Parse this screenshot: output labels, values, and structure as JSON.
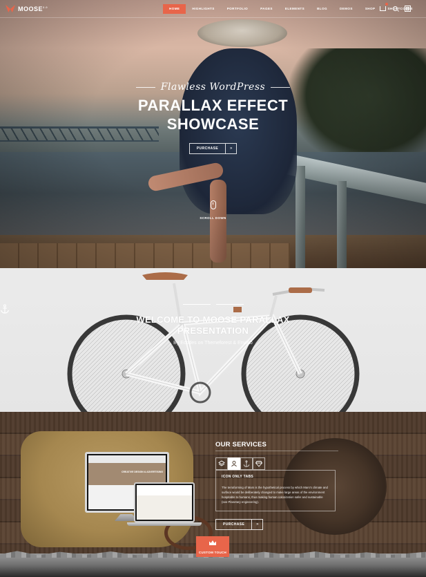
{
  "brand": {
    "name": "MOOSE",
    "version": "3.0"
  },
  "nav": {
    "items": [
      {
        "label": "HOME",
        "active": true
      },
      {
        "label": "HIGHLIGHTS"
      },
      {
        "label": "PORTFOLIO"
      },
      {
        "label": "PAGES"
      },
      {
        "label": "ELEMENTS"
      },
      {
        "label": "BLOG"
      },
      {
        "label": "DEMOS"
      },
      {
        "label": "SHOP"
      },
      {
        "label": "SHORTCODES"
      }
    ],
    "icons": [
      "cart-icon",
      "search-icon",
      "menu-icon"
    ]
  },
  "hero": {
    "script_title": "Flawless WordPress",
    "title_line1": "PARALLAX EFFECT",
    "title_line2": "SHOWCASE",
    "button_label": "PURCHASE",
    "button_arrow": "»",
    "scroll_label": "SCROLL DOWN"
  },
  "welcome": {
    "icon": "anchor-icon",
    "title_line1": "WELCOME TO MOOSE PARALLAX",
    "title_line2": "PRESENTATION",
    "subtitle": "By Ecodes on Themeforest & Envato"
  },
  "services": {
    "title": "OUR SERVICES",
    "tabs": [
      "layers-icon",
      "user-icon",
      "anchor-icon",
      "diamond-icon"
    ],
    "box_title": "ICON ONLY TABS",
    "box_text": "The terraforming of Mars is the hypothetical process by which Mars's climate and surface would be deliberately changed to make large areas of the environment hospitable to humans, thus making human colonization safer and sustainable (see Planetary engineering).",
    "button_label": "PURCHASE",
    "button_arrow": "»",
    "monitor_text": "CREATIVE DESIGN & ADVERTISING"
  },
  "footer_badge": {
    "label": "CUSTOM TOUCH",
    "icon": "crown-icon"
  },
  "colors": {
    "accent": "#e8654a"
  }
}
